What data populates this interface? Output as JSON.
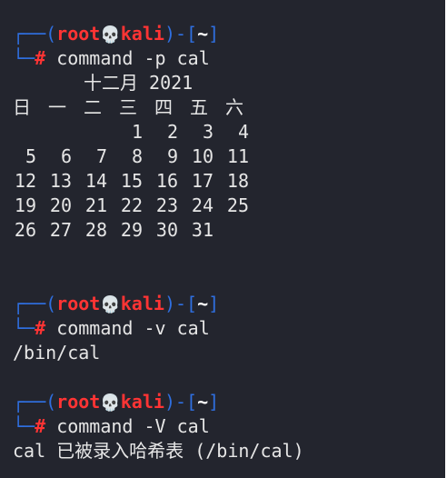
{
  "prompt": {
    "user": "root",
    "skull": "💀",
    "host": "kali",
    "dir": "~",
    "symbol": "#"
  },
  "blocks": [
    {
      "command": "command -p cal"
    },
    {
      "command": "command -v cal",
      "output": "/bin/cal"
    },
    {
      "command": "command -V cal",
      "output": "cal 已被录入哈希表 (/bin/cal)"
    }
  ],
  "calendar": {
    "header": "十二月 2021",
    "weekdays": [
      "日",
      "一",
      "二",
      "三",
      "四",
      "五",
      "六"
    ],
    "weeks": [
      [
        "",
        "",
        "",
        "1",
        "2",
        "3",
        "4"
      ],
      [
        "5",
        "6",
        "7",
        "8",
        "9",
        "10",
        "11"
      ],
      [
        "12",
        "13",
        "14",
        "15",
        "16",
        "17",
        "18"
      ],
      [
        "19",
        "20",
        "21",
        "22",
        "23",
        "24",
        "25"
      ],
      [
        "26",
        "27",
        "28",
        "29",
        "30",
        "31",
        ""
      ]
    ]
  },
  "colors": {
    "background": "#23252e",
    "prompt_frame": "#2f6fe0",
    "prompt_user": "#ff3434",
    "text": "#e6e6e6"
  }
}
